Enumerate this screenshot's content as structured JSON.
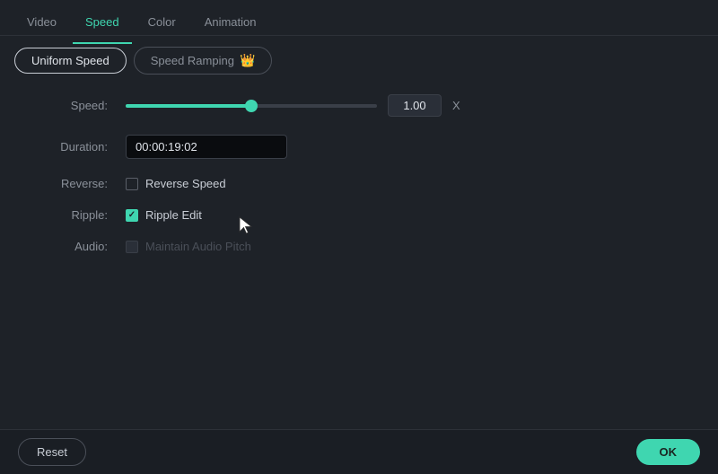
{
  "nav": {
    "tabs": [
      {
        "id": "video",
        "label": "Video",
        "active": false
      },
      {
        "id": "speed",
        "label": "Speed",
        "active": true
      },
      {
        "id": "color",
        "label": "Color",
        "active": false
      },
      {
        "id": "animation",
        "label": "Animation",
        "active": false
      }
    ]
  },
  "subtabs": {
    "uniform": {
      "label": "Uniform Speed",
      "active": true
    },
    "ramping": {
      "label": "Speed Ramping",
      "active": false
    }
  },
  "form": {
    "speed_label": "Speed:",
    "speed_value": "1.00",
    "speed_unit": "X",
    "duration_label": "Duration:",
    "duration_value": "00:00:19:02",
    "reverse_label": "Reverse:",
    "reverse_check_label": "Reverse Speed",
    "ripple_label": "Ripple:",
    "ripple_check_label": "Ripple Edit",
    "audio_label": "Audio:",
    "audio_check_label": "Maintain Audio Pitch"
  },
  "buttons": {
    "reset": "Reset",
    "ok": "OK"
  }
}
